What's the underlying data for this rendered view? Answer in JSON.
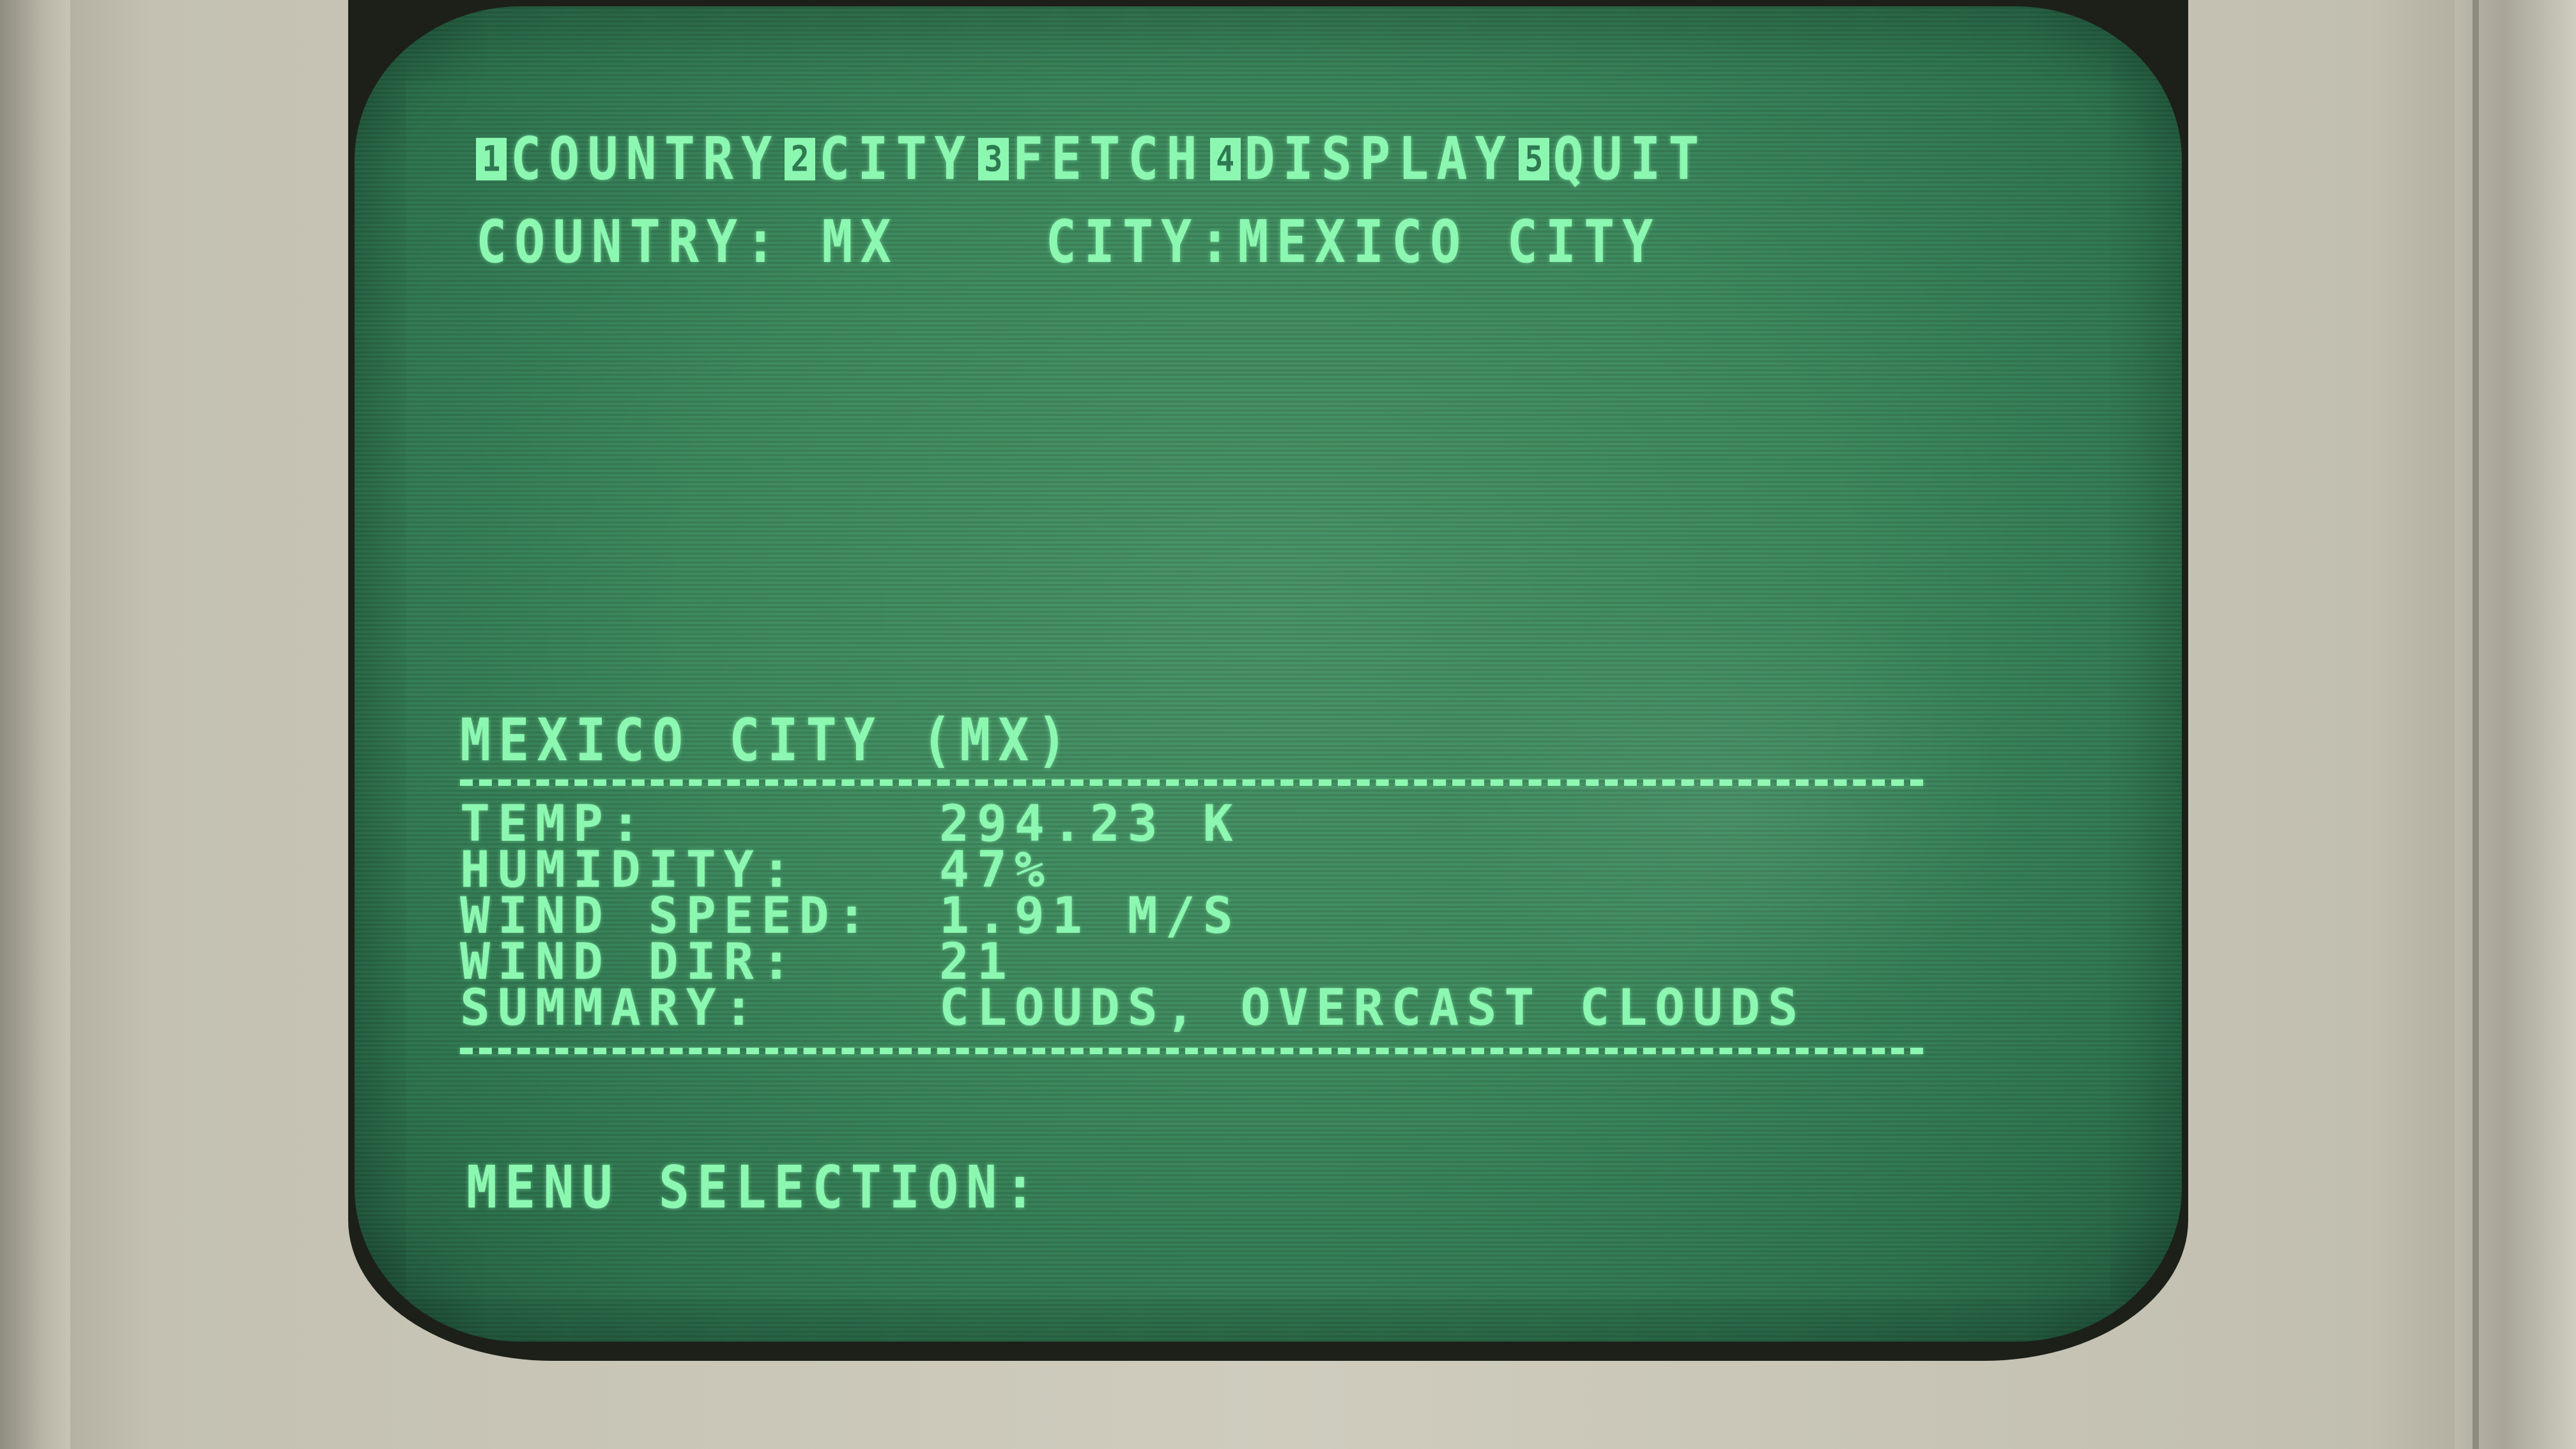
{
  "menu": {
    "items": [
      {
        "num": "1",
        "label": "COUNTRY"
      },
      {
        "num": "2",
        "label": "CITY"
      },
      {
        "num": "3",
        "label": "FETCH"
      },
      {
        "num": "4",
        "label": "DISPLAY"
      },
      {
        "num": "5",
        "label": "QUIT"
      }
    ]
  },
  "status": {
    "country_label": "COUNTRY:",
    "country_value": "MX",
    "city_label": "CITY:",
    "city_value": "MEXICO CITY"
  },
  "report": {
    "title": "MEXICO CITY (MX)",
    "rows": [
      {
        "key": "TEMP:",
        "value": "294.23 K"
      },
      {
        "key": "HUMIDITY:",
        "value": "47%"
      },
      {
        "key": "WIND SPEED:",
        "value": "1.91 M/S"
      },
      {
        "key": "WIND DIR:",
        "value": "21"
      },
      {
        "key": "SUMMARY:",
        "value": "CLOUDS, OVERCAST CLOUDS"
      }
    ]
  },
  "prompt": {
    "label": "MENU SELECTION:"
  },
  "colors": {
    "phosphor": "#8cf7b0",
    "screen": "#3e8a5e",
    "bezel": "#cfccbe"
  }
}
